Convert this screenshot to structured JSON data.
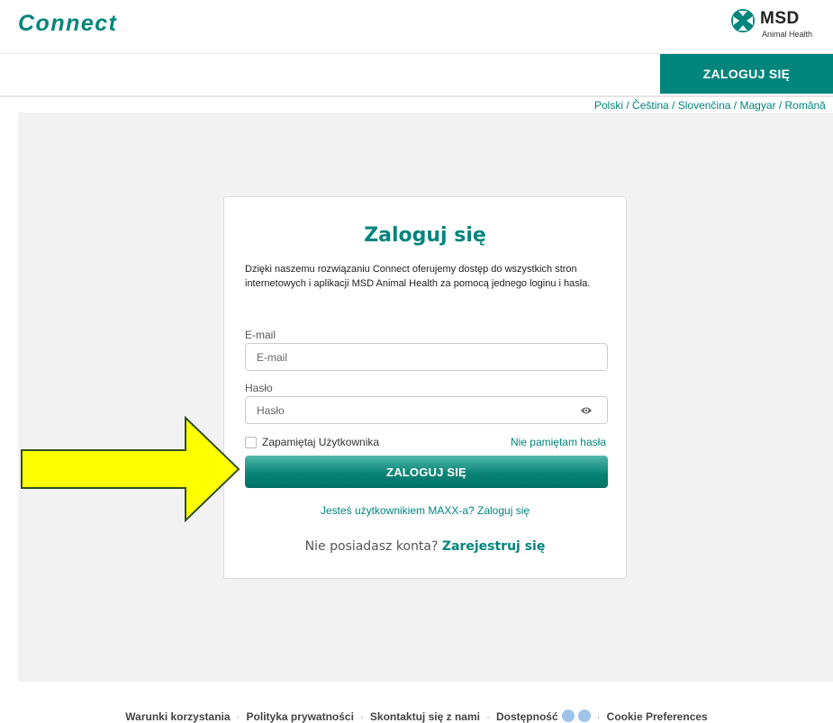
{
  "header": {
    "brand": "Connect",
    "logo_name": "MSD",
    "logo_sub": "Animal Health"
  },
  "nav": {
    "login_label": "ZALOGUJ SIĘ"
  },
  "languages": [
    "Polski",
    "Čeština",
    "Slovenčina",
    "Magyar",
    "Română"
  ],
  "login_card": {
    "title": "Zaloguj się",
    "description": "Dzięki naszemu rozwiązaniu Connect oferujemy dostęp do wszystkich stron internetowych i aplikacji MSD Animal Health za pomocą jednego loginu i hasła.",
    "email_label": "E-mail",
    "email_placeholder": "E-mail",
    "password_label": "Hasło",
    "password_placeholder": "Hasło",
    "remember_label": "Zapamiętaj Użytkownika",
    "forgot_label": "Nie pamiętam hasła",
    "submit_label": "ZALOGUJ SIĘ",
    "maxx_link": "Jesteś użytkownikiem MAXX-a? Zaloguj się",
    "register_text": "Nie posiadasz konta?",
    "register_link": "Zarejestruj się"
  },
  "footer": {
    "terms": "Warunki korzystania",
    "privacy": "Polityka prywatności",
    "contact": "Skontaktuj się z nami",
    "accessibility": "Dostępność",
    "cookies": "Cookie Preferences"
  },
  "colors": {
    "brand": "#00857c",
    "arrow_fill": "#ffff00",
    "arrow_stroke": "#2f4f1f"
  }
}
